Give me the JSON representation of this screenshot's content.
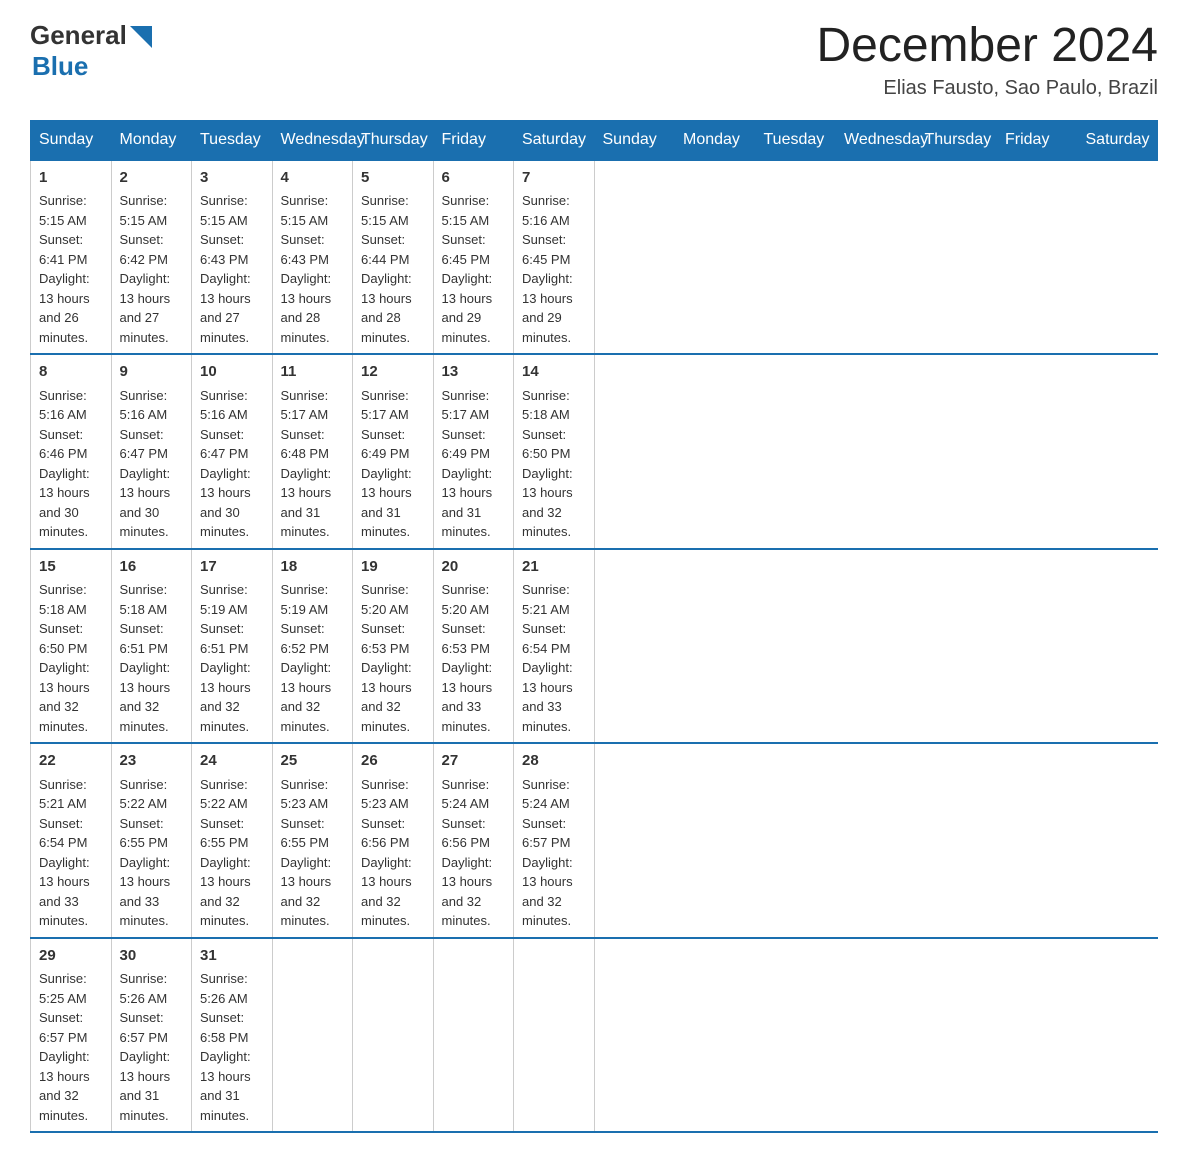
{
  "header": {
    "logo": {
      "general": "General",
      "blue": "Blue"
    },
    "title": "December 2024",
    "subtitle": "Elias Fausto, Sao Paulo, Brazil"
  },
  "columns": [
    "Sunday",
    "Monday",
    "Tuesday",
    "Wednesday",
    "Thursday",
    "Friday",
    "Saturday"
  ],
  "weeks": [
    [
      {
        "day": "1",
        "sunrise": "Sunrise: 5:15 AM",
        "sunset": "Sunset: 6:41 PM",
        "daylight": "Daylight: 13 hours and 26 minutes."
      },
      {
        "day": "2",
        "sunrise": "Sunrise: 5:15 AM",
        "sunset": "Sunset: 6:42 PM",
        "daylight": "Daylight: 13 hours and 27 minutes."
      },
      {
        "day": "3",
        "sunrise": "Sunrise: 5:15 AM",
        "sunset": "Sunset: 6:43 PM",
        "daylight": "Daylight: 13 hours and 27 minutes."
      },
      {
        "day": "4",
        "sunrise": "Sunrise: 5:15 AM",
        "sunset": "Sunset: 6:43 PM",
        "daylight": "Daylight: 13 hours and 28 minutes."
      },
      {
        "day": "5",
        "sunrise": "Sunrise: 5:15 AM",
        "sunset": "Sunset: 6:44 PM",
        "daylight": "Daylight: 13 hours and 28 minutes."
      },
      {
        "day": "6",
        "sunrise": "Sunrise: 5:15 AM",
        "sunset": "Sunset: 6:45 PM",
        "daylight": "Daylight: 13 hours and 29 minutes."
      },
      {
        "day": "7",
        "sunrise": "Sunrise: 5:16 AM",
        "sunset": "Sunset: 6:45 PM",
        "daylight": "Daylight: 13 hours and 29 minutes."
      }
    ],
    [
      {
        "day": "8",
        "sunrise": "Sunrise: 5:16 AM",
        "sunset": "Sunset: 6:46 PM",
        "daylight": "Daylight: 13 hours and 30 minutes."
      },
      {
        "day": "9",
        "sunrise": "Sunrise: 5:16 AM",
        "sunset": "Sunset: 6:47 PM",
        "daylight": "Daylight: 13 hours and 30 minutes."
      },
      {
        "day": "10",
        "sunrise": "Sunrise: 5:16 AM",
        "sunset": "Sunset: 6:47 PM",
        "daylight": "Daylight: 13 hours and 30 minutes."
      },
      {
        "day": "11",
        "sunrise": "Sunrise: 5:17 AM",
        "sunset": "Sunset: 6:48 PM",
        "daylight": "Daylight: 13 hours and 31 minutes."
      },
      {
        "day": "12",
        "sunrise": "Sunrise: 5:17 AM",
        "sunset": "Sunset: 6:49 PM",
        "daylight": "Daylight: 13 hours and 31 minutes."
      },
      {
        "day": "13",
        "sunrise": "Sunrise: 5:17 AM",
        "sunset": "Sunset: 6:49 PM",
        "daylight": "Daylight: 13 hours and 31 minutes."
      },
      {
        "day": "14",
        "sunrise": "Sunrise: 5:18 AM",
        "sunset": "Sunset: 6:50 PM",
        "daylight": "Daylight: 13 hours and 32 minutes."
      }
    ],
    [
      {
        "day": "15",
        "sunrise": "Sunrise: 5:18 AM",
        "sunset": "Sunset: 6:50 PM",
        "daylight": "Daylight: 13 hours and 32 minutes."
      },
      {
        "day": "16",
        "sunrise": "Sunrise: 5:18 AM",
        "sunset": "Sunset: 6:51 PM",
        "daylight": "Daylight: 13 hours and 32 minutes."
      },
      {
        "day": "17",
        "sunrise": "Sunrise: 5:19 AM",
        "sunset": "Sunset: 6:51 PM",
        "daylight": "Daylight: 13 hours and 32 minutes."
      },
      {
        "day": "18",
        "sunrise": "Sunrise: 5:19 AM",
        "sunset": "Sunset: 6:52 PM",
        "daylight": "Daylight: 13 hours and 32 minutes."
      },
      {
        "day": "19",
        "sunrise": "Sunrise: 5:20 AM",
        "sunset": "Sunset: 6:53 PM",
        "daylight": "Daylight: 13 hours and 32 minutes."
      },
      {
        "day": "20",
        "sunrise": "Sunrise: 5:20 AM",
        "sunset": "Sunset: 6:53 PM",
        "daylight": "Daylight: 13 hours and 33 minutes."
      },
      {
        "day": "21",
        "sunrise": "Sunrise: 5:21 AM",
        "sunset": "Sunset: 6:54 PM",
        "daylight": "Daylight: 13 hours and 33 minutes."
      }
    ],
    [
      {
        "day": "22",
        "sunrise": "Sunrise: 5:21 AM",
        "sunset": "Sunset: 6:54 PM",
        "daylight": "Daylight: 13 hours and 33 minutes."
      },
      {
        "day": "23",
        "sunrise": "Sunrise: 5:22 AM",
        "sunset": "Sunset: 6:55 PM",
        "daylight": "Daylight: 13 hours and 33 minutes."
      },
      {
        "day": "24",
        "sunrise": "Sunrise: 5:22 AM",
        "sunset": "Sunset: 6:55 PM",
        "daylight": "Daylight: 13 hours and 32 minutes."
      },
      {
        "day": "25",
        "sunrise": "Sunrise: 5:23 AM",
        "sunset": "Sunset: 6:55 PM",
        "daylight": "Daylight: 13 hours and 32 minutes."
      },
      {
        "day": "26",
        "sunrise": "Sunrise: 5:23 AM",
        "sunset": "Sunset: 6:56 PM",
        "daylight": "Daylight: 13 hours and 32 minutes."
      },
      {
        "day": "27",
        "sunrise": "Sunrise: 5:24 AM",
        "sunset": "Sunset: 6:56 PM",
        "daylight": "Daylight: 13 hours and 32 minutes."
      },
      {
        "day": "28",
        "sunrise": "Sunrise: 5:24 AM",
        "sunset": "Sunset: 6:57 PM",
        "daylight": "Daylight: 13 hours and 32 minutes."
      }
    ],
    [
      {
        "day": "29",
        "sunrise": "Sunrise: 5:25 AM",
        "sunset": "Sunset: 6:57 PM",
        "daylight": "Daylight: 13 hours and 32 minutes."
      },
      {
        "day": "30",
        "sunrise": "Sunrise: 5:26 AM",
        "sunset": "Sunset: 6:57 PM",
        "daylight": "Daylight: 13 hours and 31 minutes."
      },
      {
        "day": "31",
        "sunrise": "Sunrise: 5:26 AM",
        "sunset": "Sunset: 6:58 PM",
        "daylight": "Daylight: 13 hours and 31 minutes."
      },
      null,
      null,
      null,
      null
    ]
  ]
}
